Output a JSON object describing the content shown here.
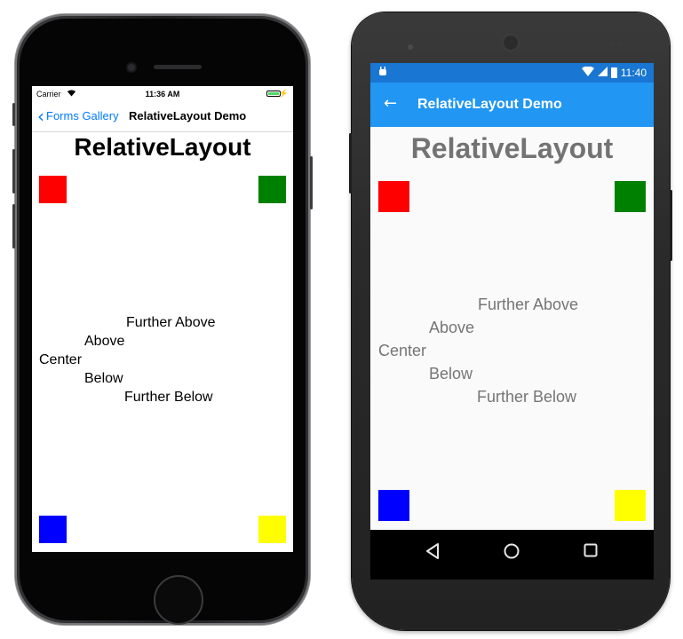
{
  "ios": {
    "status": {
      "carrier": "Carrier",
      "time": "11:36 AM"
    },
    "nav": {
      "back_label": "Forms Gallery",
      "title": "RelativeLayout Demo"
    },
    "content": {
      "heading": "RelativeLayout",
      "labels": {
        "further_above": "Further Above",
        "above": "Above",
        "center": "Center",
        "below": "Below",
        "further_below": "Further Below"
      }
    }
  },
  "android": {
    "status": {
      "time": "11:40"
    },
    "toolbar": {
      "title": "RelativeLayout Demo"
    },
    "content": {
      "heading": "RelativeLayout",
      "labels": {
        "further_above": "Further Above",
        "above": "Above",
        "center": "Center",
        "below": "Below",
        "further_below": "Further Below"
      }
    }
  },
  "colors": {
    "box_top_left": "#ff0000",
    "box_top_right": "#008000",
    "box_bottom_left": "#0000ff",
    "box_bottom_right": "#ffff00",
    "ios_tint": "#007aff",
    "android_primary": "#2196f3",
    "android_primary_dark": "#1976d2"
  },
  "icons": {
    "ios_back": "chevron-left-icon",
    "android_back": "arrow-left-icon",
    "android_nav": [
      "back-triangle-icon",
      "home-circle-icon",
      "recents-square-icon"
    ]
  }
}
